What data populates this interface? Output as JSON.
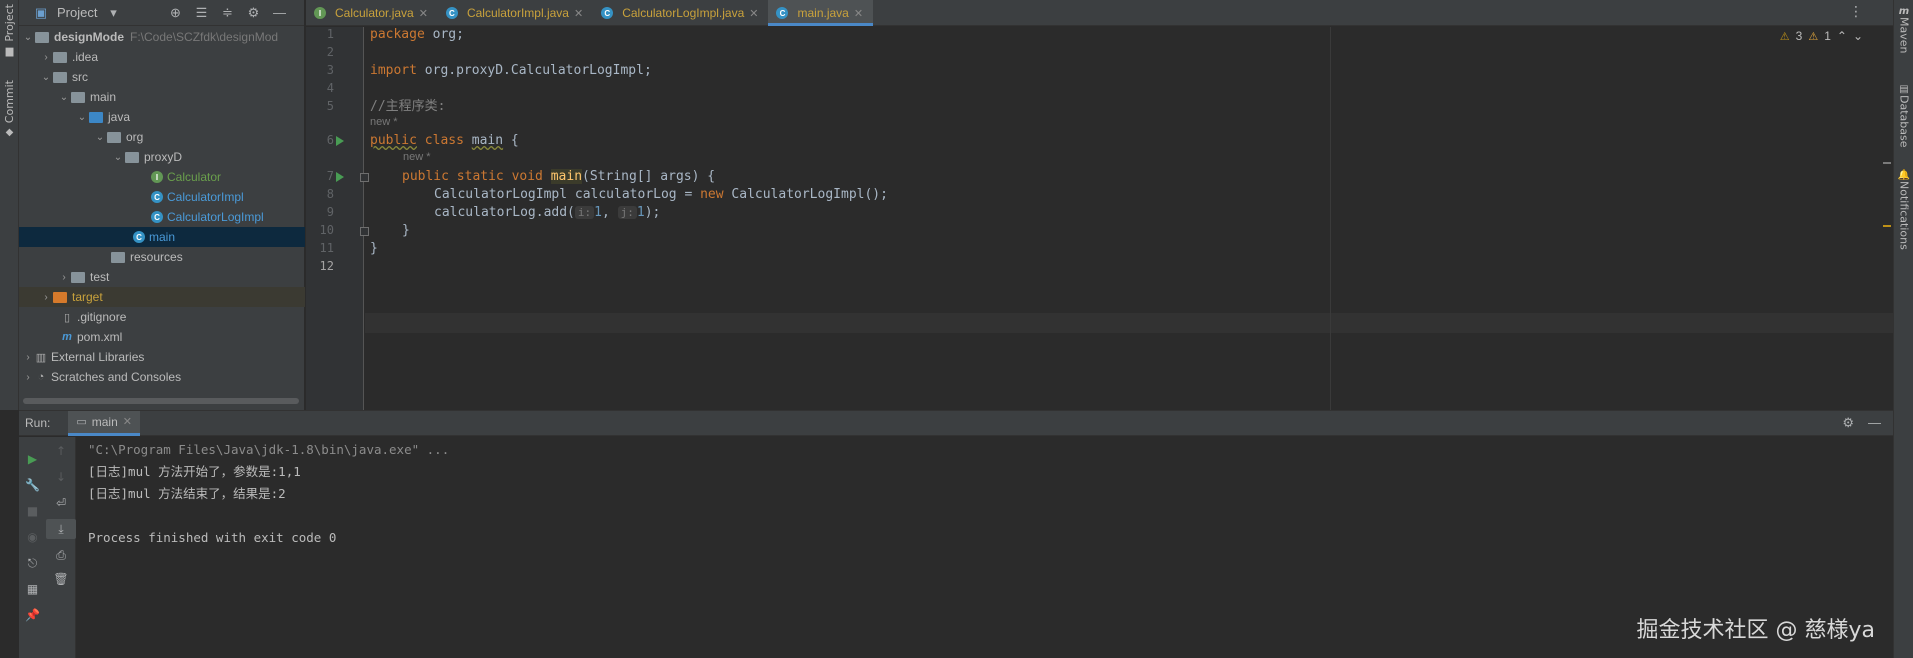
{
  "left_stripe": {
    "project": "Project",
    "commit": "Commit"
  },
  "right_stripe": {
    "maven": "Maven",
    "database": "Database",
    "notifications": "Notifications"
  },
  "project_panel": {
    "title": "Project",
    "tree": [
      {
        "label": "designMode",
        "path": "F:\\Code\\SCZfdk\\designMod",
        "indent": 0
      },
      {
        "label": ".idea"
      },
      {
        "label": "src"
      },
      {
        "label": "main"
      },
      {
        "label": "java"
      },
      {
        "label": "org"
      },
      {
        "label": "proxyD"
      },
      {
        "label": "Calculator"
      },
      {
        "label": "CalculatorImpl"
      },
      {
        "label": "CalculatorLogImpl"
      },
      {
        "label": "main"
      },
      {
        "label": "resources"
      },
      {
        "label": "test"
      },
      {
        "label": "target"
      },
      {
        "label": ".gitignore"
      },
      {
        "label": "pom.xml"
      },
      {
        "label": "External Libraries"
      },
      {
        "label": "Scratches and Consoles"
      }
    ]
  },
  "tabs": [
    {
      "label": "Calculator.java",
      "icon": "I"
    },
    {
      "label": "CalculatorImpl.java",
      "icon": "C"
    },
    {
      "label": "CalculatorLogImpl.java",
      "icon": "C"
    },
    {
      "label": "main.java",
      "icon": "C"
    }
  ],
  "editor": {
    "line_numbers": [
      "1",
      "2",
      "3",
      "4",
      "5",
      "6",
      "7",
      "8",
      "9",
      "10",
      "11",
      "12"
    ],
    "hint_new_1": "new *",
    "hint_new_2": "new *",
    "code": {
      "l1_kw": "package",
      "l1_rest": " org;",
      "l3_kw": "import",
      "l3_rest": " org.proxyD.CalculatorLogImpl;",
      "l5": "//主程序类:",
      "l6_kw1": "public",
      "l6_kw2": "class",
      "l6_name": "main",
      "l6_rest": " {",
      "l7_kw": "public static void",
      "l7_fn": "main",
      "l7_rest": "(String[] args) {",
      "l8_pre": "CalculatorLogImpl calculatorLog = ",
      "l8_kw": "new",
      "l8_rest": " CalculatorLogImpl();",
      "l9_pre": "calculatorLog.add(",
      "l9_hint1": "i:",
      "l9_v1": "1",
      "l9_sep": ", ",
      "l9_hint2": "j:",
      "l9_v2": "1",
      "l9_end": ");",
      "l10": "}",
      "l11": "}"
    },
    "inspection": {
      "warnings": "3",
      "errors": "1"
    }
  },
  "run_panel": {
    "label": "Run:",
    "tab": "main",
    "console": [
      "\"C:\\Program Files\\Java\\jdk-1.8\\bin\\java.exe\" ...",
      "[日志]mul 方法开始了，参数是:1,1",
      "[日志]mul 方法结束了，结果是:2",
      "",
      "Process finished with exit code 0"
    ]
  },
  "watermark": "掘金技术社区 @ 慈様ya"
}
